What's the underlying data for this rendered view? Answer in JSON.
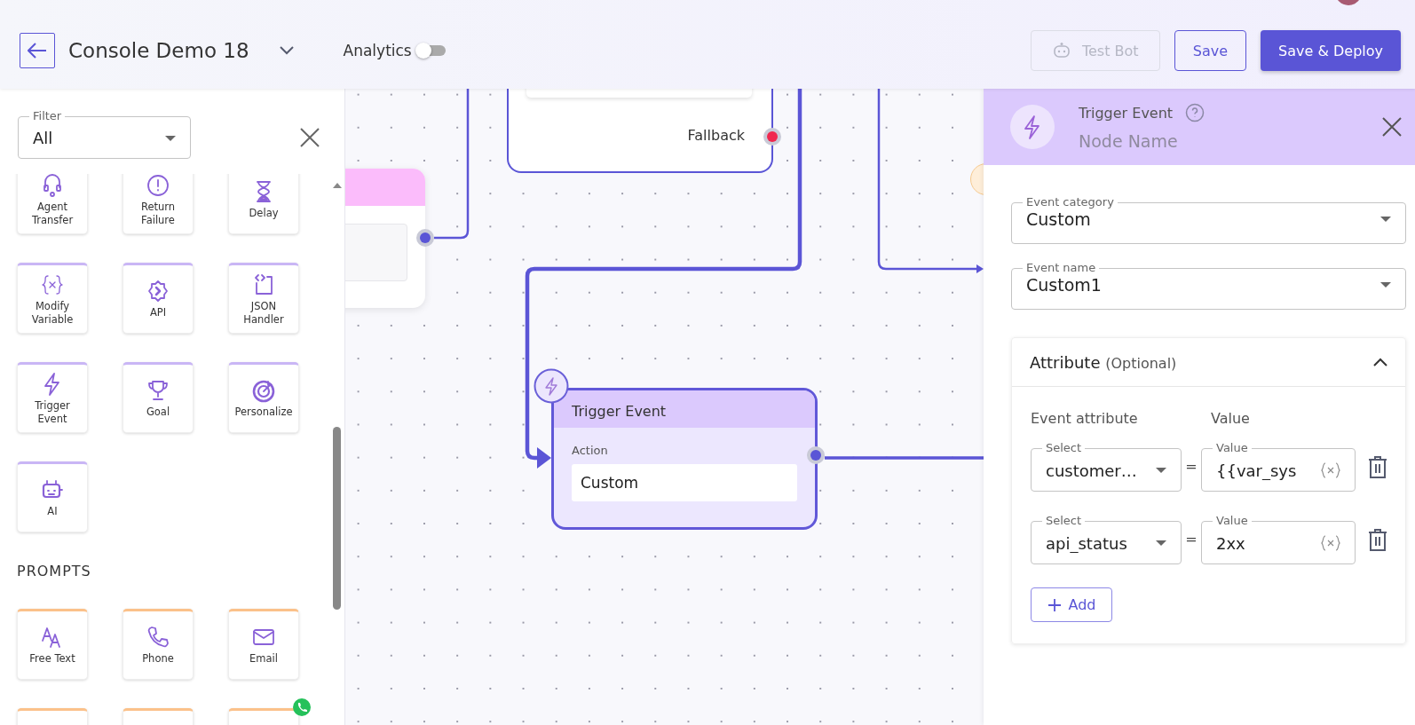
{
  "header": {
    "title": "Console Demo 18",
    "analytics": {
      "label": "Analytics",
      "on": false
    },
    "buttons": [
      {
        "label": "Test Bot",
        "kind": "bot",
        "disabled": true
      },
      {
        "label": "Save",
        "kind": "outline",
        "disabled": false
      },
      {
        "label": "Save & Deploy",
        "kind": "primary",
        "disabled": false
      }
    ]
  },
  "sidebar": {
    "filter": {
      "label": "Filter",
      "value": "All"
    },
    "sections": [
      {
        "color": "#c9b6f5",
        "tiles": [
          {
            "kind": "headset",
            "label": "Agent Transfer"
          },
          {
            "kind": "alert",
            "label": "Return Failure"
          },
          {
            "kind": "hourglass",
            "label": "Delay"
          },
          {
            "kind": "variable",
            "label": "Modify Variable"
          },
          {
            "kind": "gear",
            "label": "API"
          },
          {
            "kind": "code",
            "label": "JSON Handler"
          },
          {
            "kind": "bolt",
            "label": "Trigger Event"
          },
          {
            "kind": "trophy",
            "label": "Goal"
          },
          {
            "kind": "target",
            "label": "Personalize"
          },
          {
            "kind": "bot",
            "label": "AI"
          }
        ]
      },
      {
        "title": "PROMPTS",
        "color": "#fbc18a",
        "tiles": [
          {
            "kind": "letters",
            "label": "Free Text"
          },
          {
            "kind": "phone",
            "label": "Phone"
          },
          {
            "kind": "mail",
            "label": "Email"
          },
          {
            "kind": "blank"
          },
          {
            "kind": "blank"
          },
          {
            "kind": "blank",
            "badge": true
          }
        ]
      }
    ]
  },
  "canvas": {
    "nodes": [
      {
        "kind": "partial",
        "port_label": "Fallback"
      },
      {
        "kind": "pink"
      },
      {
        "kind": "trigger",
        "title": "Trigger Event",
        "field_label": "Action",
        "value": "Custom"
      }
    ]
  },
  "panel": {
    "title": "Trigger Event",
    "name_placeholder": "Node Name",
    "selects": [
      {
        "label": "Event category",
        "value": "Custom"
      },
      {
        "label": "Event name",
        "value": "Custom1"
      }
    ],
    "attribute": {
      "title": "Attribute",
      "note": "(Optional)",
      "expanded": true,
      "columns": [
        "Event attribute",
        "Value"
      ],
      "rows": [
        {
          "select_label": "Select",
          "select_value": "customer…",
          "equals": "=",
          "value_label": "Value",
          "value": "{{var_sys"
        },
        {
          "select_label": "Select",
          "select_value": "api_status",
          "equals": "=",
          "value_label": "Value",
          "value": "2xx"
        }
      ],
      "add_label": "Add"
    }
  }
}
